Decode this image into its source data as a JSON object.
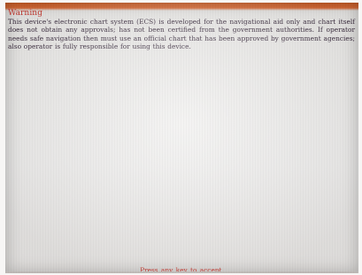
{
  "dialog": {
    "title": "Warning",
    "message": "This device's electronic chart system (ECS) is developed for the navigational aid only and chart itself does not obtain any approvals; has not been certified from the government authorities. If operator needs safe navigation then must use an official chart that has been approved by government agencies; also operator is fully responsible for using this device.",
    "prompt": "Press any key to accept."
  },
  "colors": {
    "title_bar": "#e4713a",
    "title_text": "#c7382f",
    "body_text": "#3a2c3e",
    "screen_bg": "#efeeed"
  }
}
